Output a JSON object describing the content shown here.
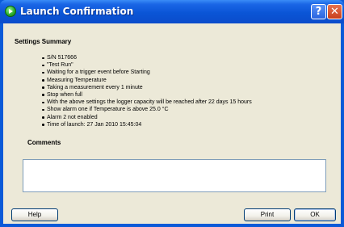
{
  "window": {
    "title": "Launch Confirmation",
    "help_glyph": "?",
    "close_glyph": "✕"
  },
  "settings": {
    "heading": "Settings Summary",
    "items": [
      "S/N 517666",
      "\"Test Run\"",
      "Waiting for a trigger event before Starting",
      "Measuring Temperature",
      "Taking a measurement every 1 minute",
      "Stop when full",
      "With the above settings the logger capacity will be reached after 22 days 15 hours",
      "Show alarm one if Temperature is above 25.0 °C",
      "Alarm 2 not enabled",
      "Time of launch: 27 Jan 2010 15:45:04"
    ]
  },
  "comments": {
    "heading": "Comments",
    "value": ""
  },
  "buttons": {
    "help": "Help",
    "print": "Print",
    "ok": "OK"
  },
  "colors": {
    "titlebar": "#0a55d6",
    "dialog_bg": "#ece9d8",
    "close_button": "#c83f1c"
  }
}
